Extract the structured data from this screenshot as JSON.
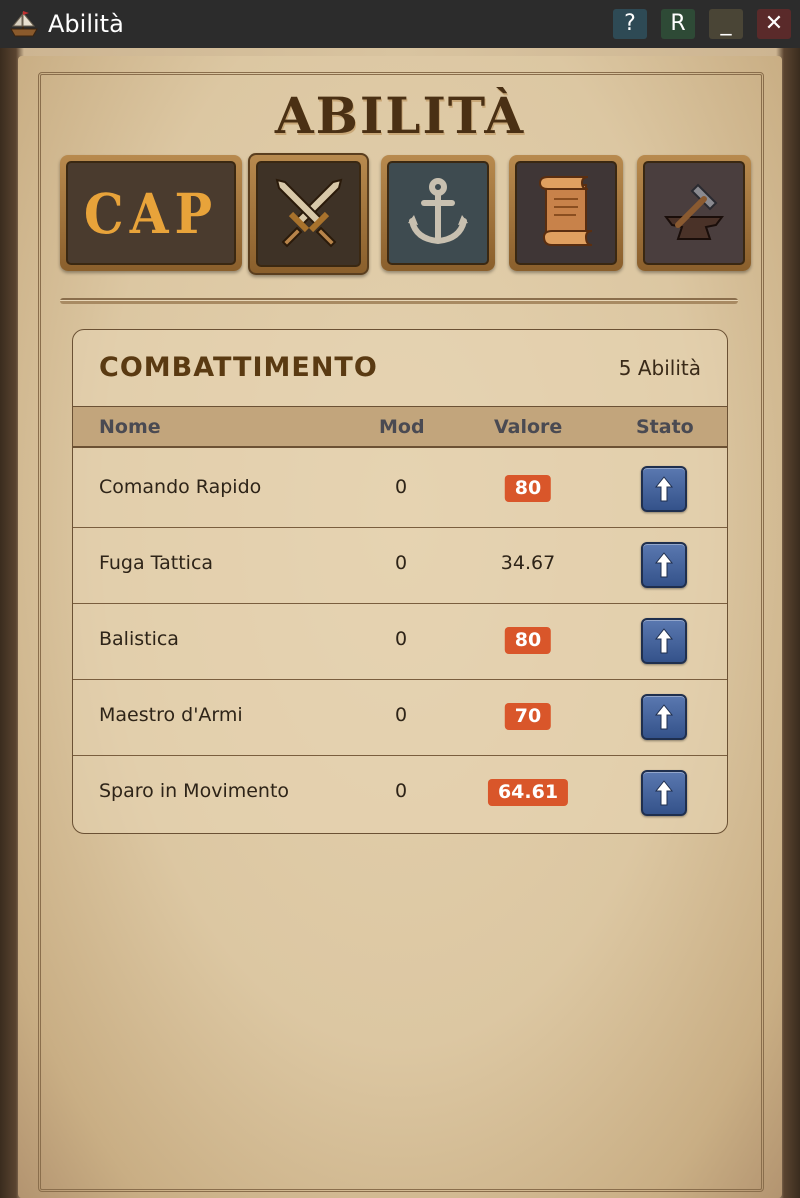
{
  "window": {
    "title": "Abilità",
    "help_label": "?",
    "r_label": "R",
    "minimize_label": "_",
    "close_label": "✕"
  },
  "heading": "ABILITÀ",
  "tabs": [
    {
      "id": "cap",
      "label": "CAP",
      "icon": "cap-text"
    },
    {
      "id": "combat",
      "icon": "crossed-swords-icon",
      "selected": true
    },
    {
      "id": "naval",
      "icon": "anchor-icon"
    },
    {
      "id": "scroll",
      "icon": "scroll-icon"
    },
    {
      "id": "craft",
      "icon": "anvil-hammer-icon"
    }
  ],
  "panel": {
    "title": "COMBATTIMENTO",
    "count": "5 Abilità",
    "columns": {
      "name": "Nome",
      "mod": "Mod",
      "value": "Valore",
      "state": "Stato"
    },
    "rows": [
      {
        "name": "Comando Rapido",
        "mod": "0",
        "value": "80",
        "highlight": true
      },
      {
        "name": "Fuga Tattica",
        "mod": "0",
        "value": "34.67",
        "highlight": false
      },
      {
        "name": "Balistica",
        "mod": "0",
        "value": "80",
        "highlight": true
      },
      {
        "name": "Maestro d'Armi",
        "mod": "0",
        "value": "70",
        "highlight": true
      },
      {
        "name": "Sparo in Movimento",
        "mod": "0",
        "value": "64.61",
        "highlight": true
      }
    ]
  },
  "colors": {
    "badge": "#d9562a",
    "upgrade_button": "#4a68a0",
    "title_text": "#5a3a12"
  }
}
